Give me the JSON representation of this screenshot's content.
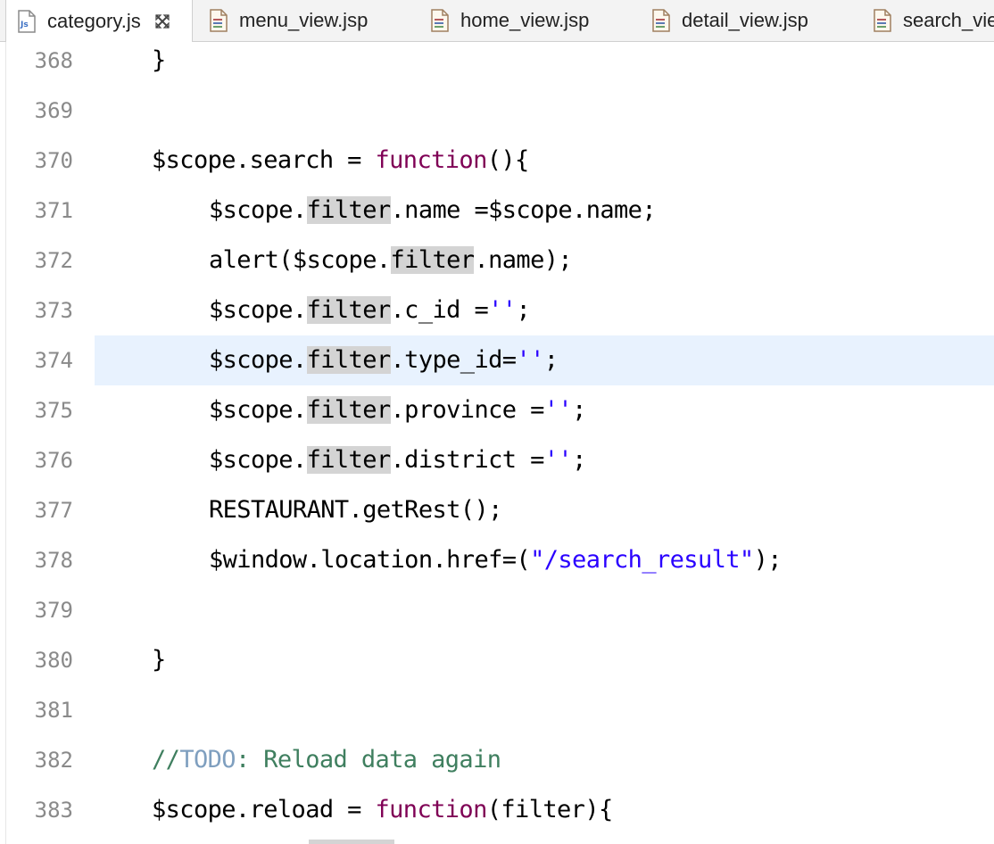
{
  "tabs": [
    {
      "label": "category.js",
      "icon": "js-file-icon",
      "active": true,
      "closable": true
    },
    {
      "label": "menu_view.jsp",
      "icon": "jsp-file-icon"
    },
    {
      "label": "home_view.jsp",
      "icon": "jsp-file-icon"
    },
    {
      "label": "detail_view.jsp",
      "icon": "jsp-file-icon"
    },
    {
      "label": "search_vie",
      "icon": "jsp-file-icon"
    }
  ],
  "editor": {
    "current_line": "374",
    "lines": [
      {
        "num": "368",
        "segments": [
          {
            "t": "}"
          }
        ]
      },
      {
        "num": "369",
        "segments": []
      },
      {
        "num": "370",
        "segments": [
          {
            "t": "$scope.search = "
          },
          {
            "t": "function",
            "c": "kw"
          },
          {
            "t": "(){"
          }
        ]
      },
      {
        "num": "371",
        "segments": [
          {
            "t": "$scope."
          },
          {
            "t": "filter",
            "c": "occ"
          },
          {
            "t": ".name =$scope.name;"
          }
        ]
      },
      {
        "num": "372",
        "segments": [
          {
            "t": "alert($scope."
          },
          {
            "t": "filter",
            "c": "occ"
          },
          {
            "t": ".name);"
          }
        ]
      },
      {
        "num": "373",
        "segments": [
          {
            "t": "$scope."
          },
          {
            "t": "filter",
            "c": "occ"
          },
          {
            "t": ".c_id ="
          },
          {
            "t": "''",
            "c": "str"
          },
          {
            "t": ";"
          }
        ]
      },
      {
        "num": "374",
        "segments": [
          {
            "t": "$scope."
          },
          {
            "t": "filter",
            "c": "occ"
          },
          {
            "t": ".type_id="
          },
          {
            "t": "''",
            "c": "str"
          },
          {
            "t": ";"
          }
        ]
      },
      {
        "num": "375",
        "segments": [
          {
            "t": "$scope."
          },
          {
            "t": "filter",
            "c": "occ"
          },
          {
            "t": ".province ="
          },
          {
            "t": "''",
            "c": "str"
          },
          {
            "t": ";"
          }
        ]
      },
      {
        "num": "376",
        "segments": [
          {
            "t": "$scope."
          },
          {
            "t": "filter",
            "c": "occ"
          },
          {
            "t": ".district ="
          },
          {
            "t": "''",
            "c": "str"
          },
          {
            "t": ";"
          }
        ]
      },
      {
        "num": "377",
        "segments": [
          {
            "t": "RESTAURANT.getRest();"
          }
        ]
      },
      {
        "num": "378",
        "segments": [
          {
            "t": "$window.location.href=("
          },
          {
            "t": "\"/search_result\"",
            "c": "str"
          },
          {
            "t": ");"
          }
        ]
      },
      {
        "num": "379",
        "segments": []
      },
      {
        "num": "380",
        "segments": [
          {
            "t": "}"
          }
        ]
      },
      {
        "num": "381",
        "segments": []
      },
      {
        "num": "382",
        "segments": [
          {
            "t": "//",
            "c": "cmt"
          },
          {
            "t": "TODO",
            "c": "todo"
          },
          {
            "t": ": Reload data again",
            "c": "cmt"
          }
        ]
      },
      {
        "num": "383",
        "segments": [
          {
            "t": "$scope.reload = "
          },
          {
            "t": "function",
            "c": "kw"
          },
          {
            "t": "(filter){"
          }
        ]
      }
    ]
  },
  "colors": {
    "keyword": "#7f0055",
    "string": "#2a00ff",
    "comment": "#3f7f5f",
    "todo": "#7f9fbf",
    "current_line_bg": "#e8f2fe",
    "occurrence_bg": "#d4d4d4"
  }
}
